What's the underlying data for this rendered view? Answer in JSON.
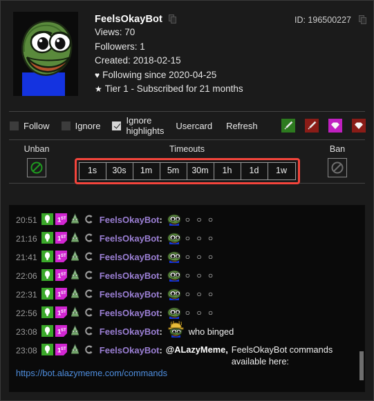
{
  "profile": {
    "avatar_name": "pepe-avatar",
    "username": "FeelsOkayBot",
    "id_label": "ID: 196500227",
    "views": "Views: 70",
    "followers": "Followers: 1",
    "created": "Created: 2018-02-15",
    "heart_glyph": "♥",
    "following": "Following since 2020-04-25",
    "star_glyph": "★",
    "subscription": "Tier 1 - Subscribed for 21 months"
  },
  "actionbar": {
    "follow": {
      "label": "Follow",
      "checked": false
    },
    "ignore": {
      "label": "Ignore",
      "checked": false
    },
    "ignore_highlights": {
      "label": "Ignore highlights",
      "checked": true
    },
    "usercard": "Usercard",
    "refresh": "Refresh",
    "icons": [
      {
        "name": "sword-green-icon",
        "color": "#2d7a1f"
      },
      {
        "name": "sword-red-icon",
        "color": "#8a1c17"
      },
      {
        "name": "gem-magenta-icon",
        "color": "#c020c0"
      },
      {
        "name": "gem-red-icon",
        "color": "#8a1c17"
      }
    ]
  },
  "moderation": {
    "unban_label": "Unban",
    "unban_icon_color": "#1f9b20",
    "timeouts_label": "Timeouts",
    "timeout_buttons": [
      "1s",
      "30s",
      "1m",
      "5m",
      "30m",
      "1h",
      "1d",
      "1w"
    ],
    "highlight_color": "#f4453c",
    "ban_label": "Ban",
    "ban_icon_color": "#6e6e6e"
  },
  "chat": {
    "author": "FeelsOkayBot",
    "colon": ":",
    "dots": "○ ○ ○",
    "messages": [
      {
        "time": "20:51",
        "type": "emote-dots"
      },
      {
        "time": "21:16",
        "type": "emote-dots"
      },
      {
        "time": "21:41",
        "type": "emote-dots"
      },
      {
        "time": "22:06",
        "type": "emote-dots"
      },
      {
        "time": "22:31",
        "type": "emote-dots"
      },
      {
        "time": "22:56",
        "type": "emote-dots"
      },
      {
        "time": "23:08",
        "type": "emote-text",
        "text": "who binged"
      },
      {
        "time": "23:08",
        "type": "link",
        "mention": "@ALazyMeme,",
        "text": "FeelsOkayBot commands available here:",
        "link": "https://bot.alazymeme.com/commands"
      }
    ],
    "badges": [
      {
        "name": "badge-green-balloon"
      },
      {
        "name": "badge-first-magenta"
      },
      {
        "name": "badge-gnome"
      },
      {
        "name": "badge-c-logo"
      }
    ]
  }
}
